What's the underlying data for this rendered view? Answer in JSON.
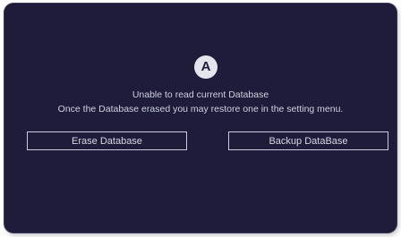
{
  "dialog": {
    "logo_letter": "A",
    "message_line1": "Unable to read current Database",
    "message_line2": "Once the Database erased you may restore one in the setting menu.",
    "erase_button_label": "Erase Database",
    "backup_button_label": "Backup DataBase"
  },
  "colors": {
    "panel_background": "#1e1c3a",
    "text": "#cfd0e0",
    "button_border": "#c9cbe0",
    "logo_background": "#e4e4ec"
  }
}
